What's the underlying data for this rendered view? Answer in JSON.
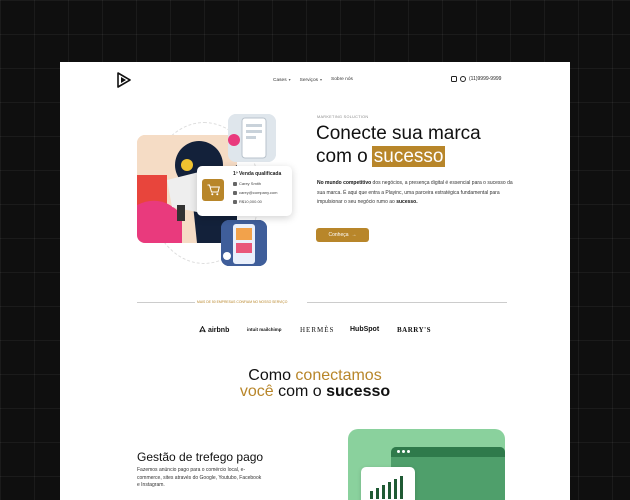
{
  "nav": {
    "items": [
      {
        "label": "Cases",
        "caret": "▾"
      },
      {
        "label": "Serviços",
        "caret": "▾"
      },
      {
        "label": "Sobre nós",
        "caret": ""
      }
    ]
  },
  "contact": {
    "phone": "(11)9999-9999",
    "icons": [
      "instagram-icon",
      "whatsapp-icon"
    ]
  },
  "hero": {
    "eyebrow": "MARKETING SOLUCTION",
    "title_line1": "Conecte sua marca",
    "title_line2_prefix": "com o",
    "title_highlight": "sucesso",
    "paragraph_bold": "No mundo competitivo",
    "paragraph_rest": " dos negócios, a presença digital é essencial para o sucesso da sua marca. É aqui que entra a Playinc, uma parceira estratégica fundamental para impulsionar o seu negócio rumo ao ",
    "paragraph_end": "sucesso.",
    "cta_label": "Conheça",
    "cta_arrow": "→"
  },
  "lead_card": {
    "title": "1º Venda qualificada",
    "name": "Carey Smith",
    "email": "carey@company.com",
    "value": "R$10,000.00"
  },
  "clients": {
    "label": "MAIS DE 50 EMPRESAS CONFIAM NO NOSSO SERVIÇO",
    "brands": [
      "airbnb",
      "intuit mailchimp",
      "HERMÈS",
      "HubSpot",
      "BARRY'S"
    ]
  },
  "section": {
    "line1_a": "Como ",
    "line1_b": "conectamos",
    "line2_a": "você",
    "line2_b": " com o ",
    "line2_c": "sucesso"
  },
  "service": {
    "title": "Gestão de trefego pago",
    "description": "Fazemos anúncio pago para o comércio local, e-commerce, sites através do Google, Youtubo, Facebook e Instagram."
  },
  "colors": {
    "accent": "#b8862a",
    "panel_green": "#8ad19d"
  }
}
